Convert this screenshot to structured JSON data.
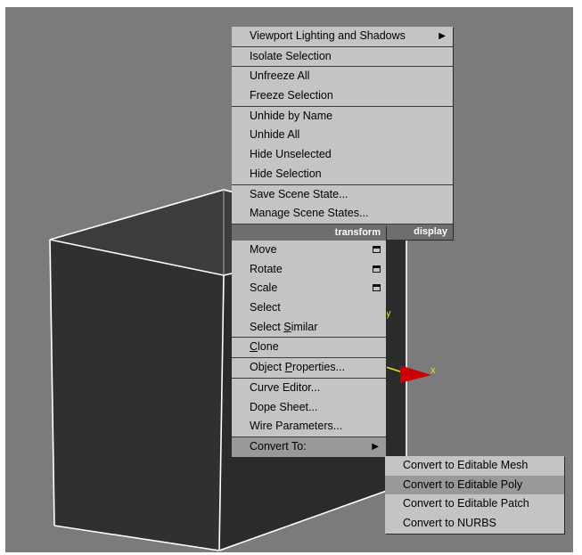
{
  "display_menu": {
    "items": [
      {
        "label": "Viewport Lighting and Shadows",
        "submenu": true
      },
      {
        "label": "Isolate Selection"
      },
      {
        "label": "Unfreeze All"
      },
      {
        "label": "Freeze Selection"
      },
      {
        "label": "Unhide by Name"
      },
      {
        "label": "Unhide All"
      },
      {
        "label": "Hide Unselected"
      },
      {
        "label": "Hide Selection"
      },
      {
        "label": "Save Scene State..."
      },
      {
        "label": "Manage Scene States..."
      }
    ],
    "quad_label": "display"
  },
  "transform_menu": {
    "quad_label": "transform",
    "items": [
      {
        "label": "Move"
      },
      {
        "label": "Rotate"
      },
      {
        "label": "Scale"
      },
      {
        "label": "Select"
      },
      {
        "label": "Select Similar",
        "underline": "S"
      },
      {
        "label": "Clone",
        "underline": "C"
      },
      {
        "label": "Object Properties...",
        "underline": "P"
      },
      {
        "label": "Curve Editor..."
      },
      {
        "label": "Dope Sheet..."
      },
      {
        "label": "Wire Parameters..."
      },
      {
        "label": "Convert To:"
      }
    ]
  },
  "convert_submenu": {
    "items": [
      {
        "label": "Convert to Editable Mesh"
      },
      {
        "label": "Convert to Editable Poly",
        "highlighted": true
      },
      {
        "label": "Convert to Editable Patch"
      },
      {
        "label": "Convert to NURBS"
      }
    ]
  },
  "gizmo": {
    "x_label": "x",
    "y_label": "y"
  },
  "colors": {
    "viewport_bg": "#7b7b7b",
    "menu_bg": "#c4c4c4",
    "highlight": "#999999",
    "quad_label_bg": "#6e6e6e",
    "gizmo_x": "#cc0000",
    "gizmo_label": "#e3e326"
  }
}
